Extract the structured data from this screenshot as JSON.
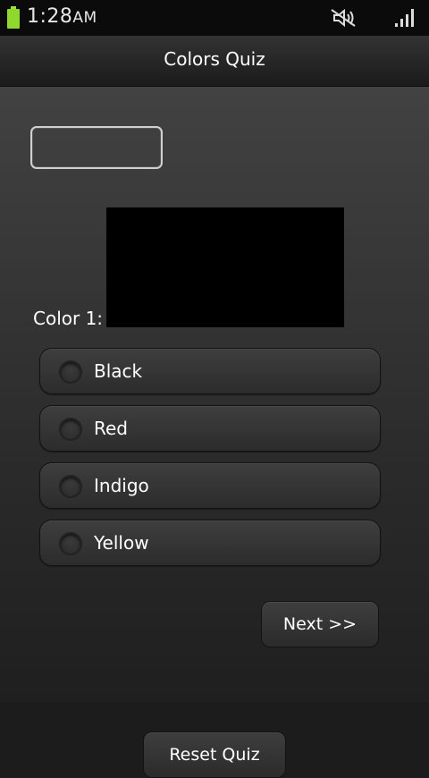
{
  "status_bar": {
    "time": "1:28",
    "ampm": "AM",
    "battery_color": "#8fd92f",
    "icons": [
      "battery-icon",
      "mute-icon",
      "signal-icon"
    ]
  },
  "app": {
    "title": "Colors Quiz"
  },
  "quiz": {
    "answer_value": "",
    "color_label": "Color 1:",
    "swatch_color": "#000000",
    "options": [
      {
        "label": "Black",
        "selected": false
      },
      {
        "label": "Red",
        "selected": false
      },
      {
        "label": "Indigo",
        "selected": false
      },
      {
        "label": "Yellow",
        "selected": false
      }
    ],
    "next_label": "Next >>",
    "reset_label": "Reset Quiz"
  }
}
